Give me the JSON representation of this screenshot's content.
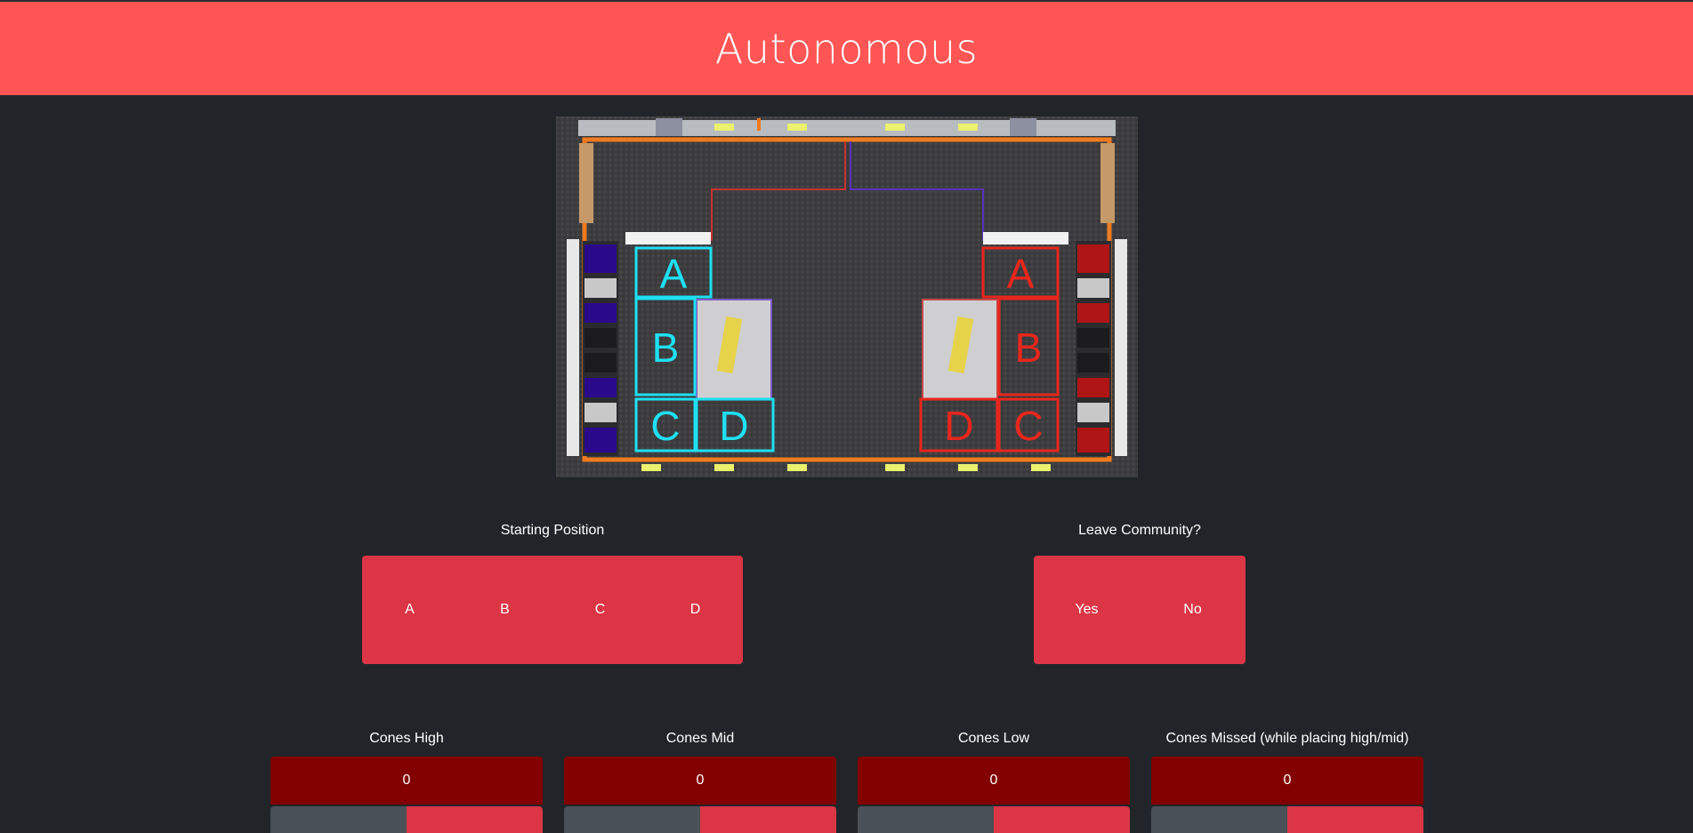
{
  "header": {
    "title": "Autonomous"
  },
  "field_map": {
    "blue_zones": [
      "A",
      "B",
      "C",
      "D"
    ],
    "red_zones": [
      "A",
      "B",
      "C",
      "D"
    ],
    "colors": {
      "blue_zone": "#1ee0f2",
      "red_zone": "#e8261c",
      "carpet": "#3c3c3e",
      "border": "#f07a1e",
      "blue_alliance": "#2a0a8a",
      "red_alliance": "#b01515"
    }
  },
  "starting_position": {
    "label": "Starting Position",
    "options": [
      "A",
      "B",
      "C",
      "D"
    ]
  },
  "leave_community": {
    "label": "Leave Community?",
    "options": [
      "Yes",
      "No"
    ]
  },
  "counters": [
    {
      "label": "Cones High",
      "value": "0"
    },
    {
      "label": "Cones Mid",
      "value": "0"
    },
    {
      "label": "Cones Low",
      "value": "0"
    },
    {
      "label": "Cones Missed (while placing high/mid)",
      "value": "0"
    }
  ],
  "colors": {
    "header": "#ff5555",
    "background": "#212529",
    "button": "#dc3545",
    "counter": "#820000",
    "decrement": "#495057"
  }
}
